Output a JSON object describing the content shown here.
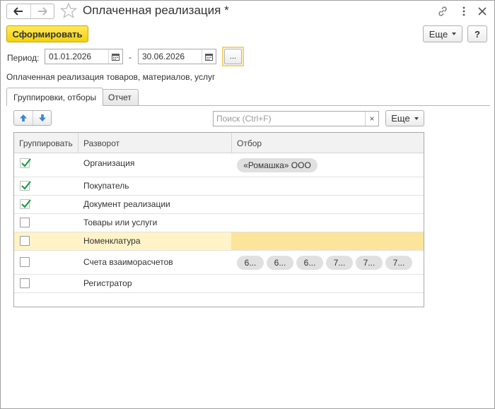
{
  "window": {
    "title": "Оплаченная реализация *",
    "back_icon": "arrow-left-icon",
    "forward_icon": "arrow-right-icon"
  },
  "toolbar": {
    "generate_label": "Сформировать",
    "more_label": "Еще",
    "help_label": "?"
  },
  "period": {
    "label": "Период:",
    "start": "01.01.2026",
    "separator": "-",
    "end": "30.06.2026",
    "dots_label": "..."
  },
  "report_description": "Оплаченная реализация товаров, материалов, услуг",
  "tabs": [
    {
      "label": "Группировки, отборы",
      "active": true
    },
    {
      "label": "Отчет",
      "active": false
    }
  ],
  "groupings": {
    "search_placeholder": "Поиск (Ctrl+F)",
    "clear_label": "×",
    "more_label": "Еще",
    "columns": [
      "Группировать",
      "Разворот",
      "Отбор"
    ],
    "rows": [
      {
        "checked": true,
        "name": "Организация",
        "filters": [
          "«Ромашка» ООО"
        ]
      },
      {
        "checked": true,
        "name": "Покупатель",
        "filters": []
      },
      {
        "checked": true,
        "name": "Документ реализации",
        "filters": []
      },
      {
        "checked": false,
        "name": "Товары или услуги",
        "filters": []
      },
      {
        "checked": false,
        "name": "Номенклатура",
        "filters": [],
        "selected": true
      },
      {
        "checked": false,
        "name": "Счета взаиморасчетов",
        "filters": [
          "6...",
          "6...",
          "6...",
          "7...",
          "7...",
          "7..."
        ]
      },
      {
        "checked": false,
        "name": "Регистратор",
        "filters": []
      }
    ]
  },
  "colors": {
    "primary_button": "#f2d20c",
    "selected_row": "#fff3c7",
    "selected_cell": "#fce59a",
    "check": "#1a9e3f"
  }
}
